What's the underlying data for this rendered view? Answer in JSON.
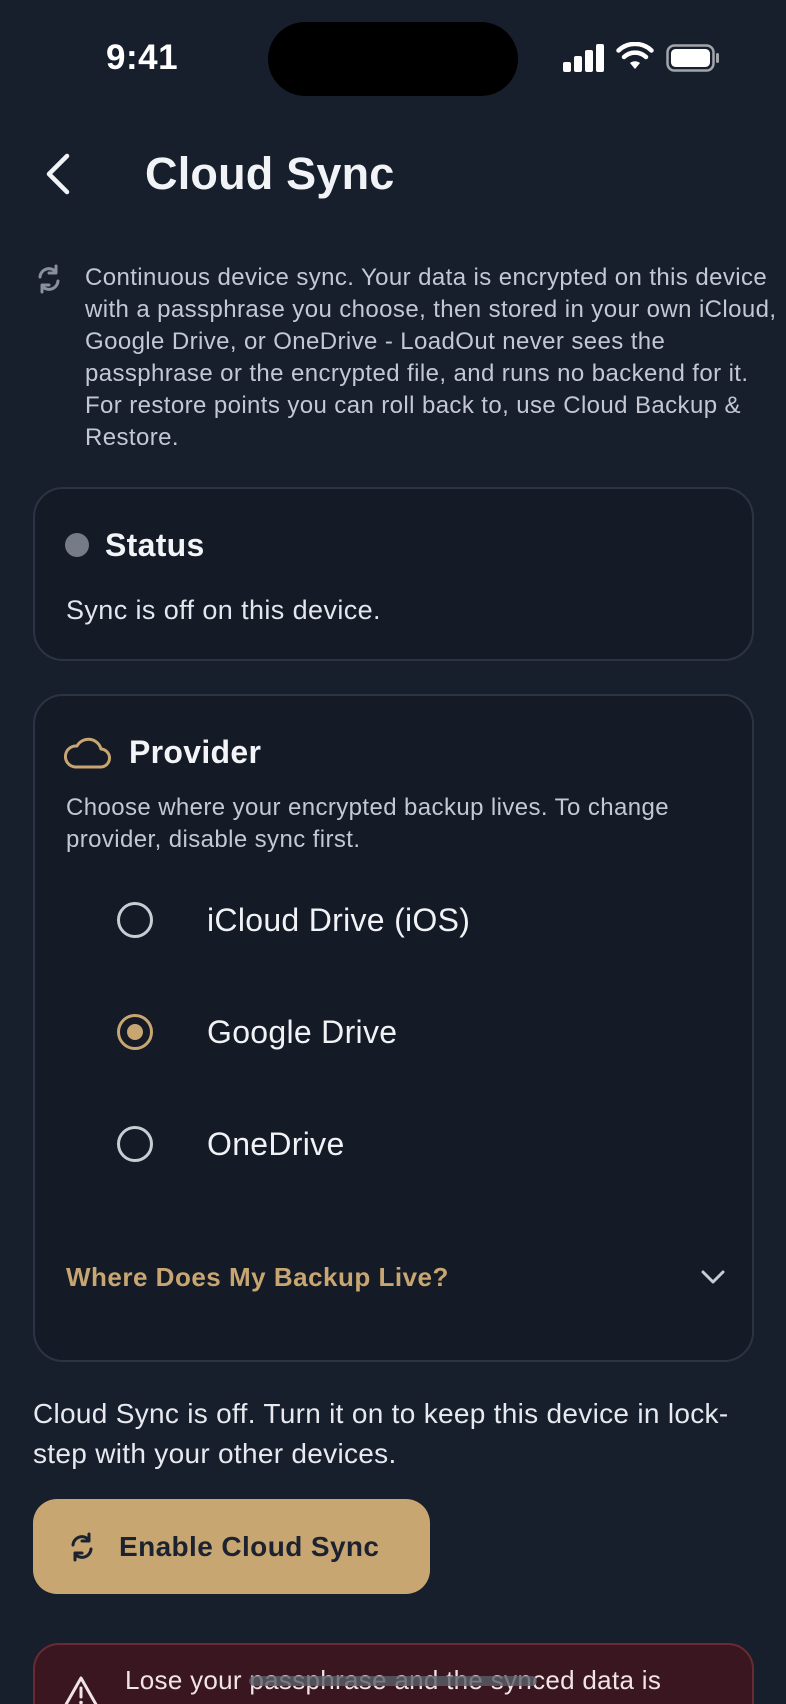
{
  "status_bar": {
    "time": "9:41"
  },
  "header": {
    "title": "Cloud Sync"
  },
  "intro": {
    "text": "Continuous device sync. Your data is encrypted on this device with a passphrase you choose, then stored in your own iCloud, Google Drive, or OneDrive - LoadOut never sees the passphrase or the encrypted file, and runs no backend for it. For restore points you can roll back to, use Cloud Backup & Restore."
  },
  "status_card": {
    "title": "Status",
    "text": "Sync is off on this device."
  },
  "provider_card": {
    "title": "Provider",
    "description": "Choose where your encrypted backup lives. To change provider, disable sync first.",
    "options": [
      {
        "label": "iCloud Drive (iOS)",
        "selected": false
      },
      {
        "label": "Google Drive",
        "selected": true
      },
      {
        "label": "OneDrive",
        "selected": false
      }
    ],
    "expander_label": "Where Does My Backup Live?"
  },
  "sync_off_text": "Cloud Sync is off. Turn it on to keep this device in lock-step with your other devices.",
  "enable_button": {
    "label": "Enable Cloud Sync"
  },
  "warning": {
    "text": "Lose your passphrase and the synced data is"
  },
  "colors": {
    "background": "#171e2c",
    "card": "#141a26",
    "accent": "#c8a672",
    "warning_bg": "#3a1620"
  }
}
